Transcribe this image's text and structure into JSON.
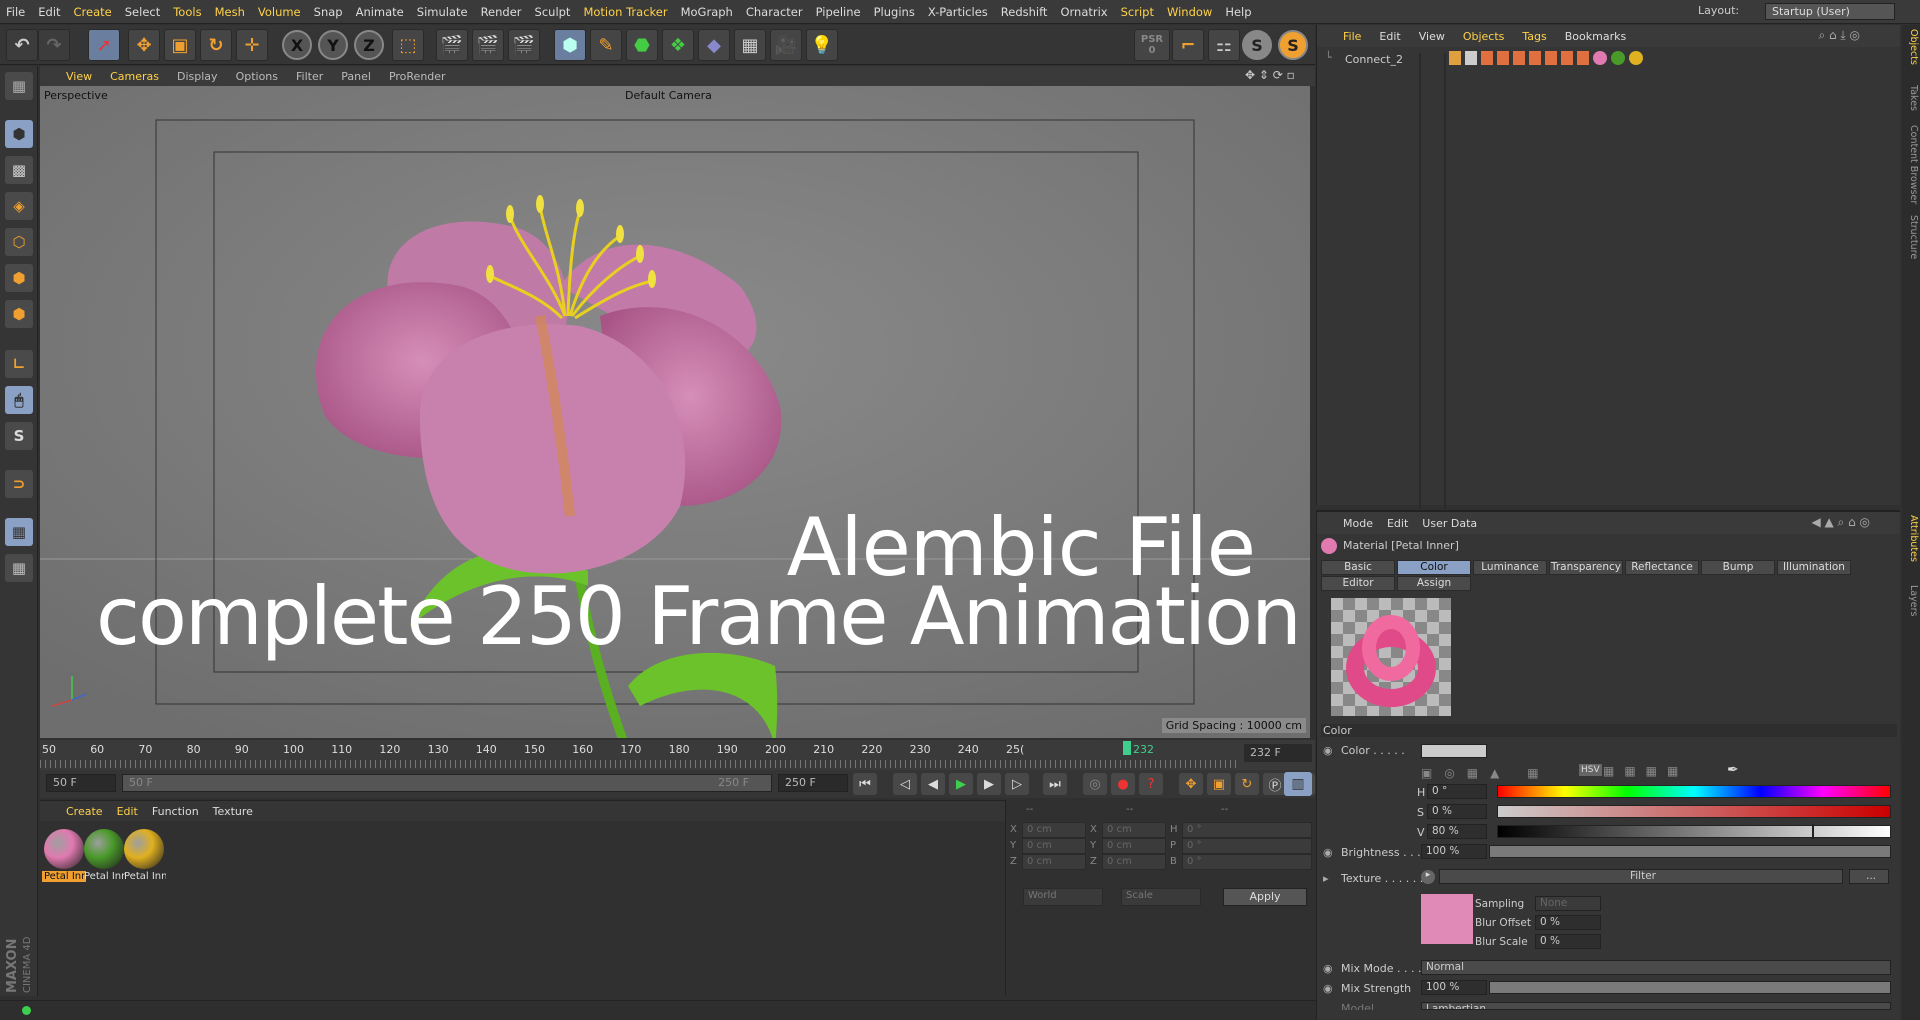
{
  "menu": [
    "File",
    "Edit",
    "Create",
    "Select",
    "Tools",
    "Mesh",
    "Volume",
    "Snap",
    "Animate",
    "Simulate",
    "Render",
    "Sculpt",
    "Motion Tracker",
    "MoGraph",
    "Character",
    "Pipeline",
    "Plugins",
    "X-Particles",
    "Redshift",
    "Ornatrix",
    "Script",
    "Window",
    "Help"
  ],
  "highlighted_menu": [
    "Create",
    "Tools",
    "Mesh",
    "Volume",
    "Motion Tracker",
    "Script",
    "Window"
  ],
  "layout": {
    "label": "Layout:",
    "value": "Startup (User)"
  },
  "toolbar": {
    "axis_x": "X",
    "axis_y": "Y",
    "axis_z": "Z",
    "psr_label": "PSR",
    "psr_value": "0",
    "snap_s1": "S",
    "snap_s2": "S"
  },
  "viewport": {
    "menu": [
      "View",
      "Cameras",
      "Display",
      "Options",
      "Filter",
      "Panel",
      "ProRender"
    ],
    "projection": "Perspective",
    "camera": "Default Camera",
    "overlay_title": "Alembic File",
    "overlay_subtitle": "complete 250 Frame Animation",
    "grid_spacing": "Grid Spacing : 10000 cm"
  },
  "timeline": {
    "ticks": [
      "50",
      "60",
      "70",
      "80",
      "90",
      "100",
      "110",
      "120",
      "130",
      "140",
      "150",
      "160",
      "170",
      "180",
      "190",
      "200",
      "210",
      "220",
      "230",
      "240",
      "25("
    ],
    "current_marker": "232",
    "current_frame": "232 F"
  },
  "transport": {
    "start": "50 F",
    "range_start": "50 F",
    "range_end": "250 F",
    "end": "250 F"
  },
  "material_manager": {
    "menu": [
      "Create",
      "Edit",
      "Function",
      "Texture"
    ],
    "materials": [
      {
        "label": "Petal Inn",
        "color": "#e07ab0",
        "selected": true
      },
      {
        "label": "Petal Inn",
        "color": "#4a9a2a",
        "selected": false
      },
      {
        "label": "Petal Inn",
        "color": "#e0b020",
        "selected": false
      }
    ]
  },
  "coords": {
    "header": [
      "--",
      "--",
      "--"
    ],
    "rows": [
      {
        "a": "X",
        "av": "0 cm",
        "b": "X",
        "bv": "0 cm",
        "c": "H",
        "cv": "0 °"
      },
      {
        "a": "Y",
        "av": "0 cm",
        "b": "Y",
        "bv": "0 cm",
        "c": "P",
        "cv": "0 °"
      },
      {
        "a": "Z",
        "av": "0 cm",
        "b": "Z",
        "bv": "0 cm",
        "c": "B",
        "cv": "0 °"
      }
    ],
    "mode1": "World",
    "mode2": "Scale",
    "apply": "Apply"
  },
  "object_manager": {
    "menu": [
      "File",
      "Edit",
      "View",
      "Objects",
      "Tags",
      "Bookmarks"
    ],
    "object_name": "Connect_2"
  },
  "attributes": {
    "menu": [
      "Mode",
      "Edit",
      "User Data"
    ],
    "title": "Material [Petal Inner]",
    "tabs_row1": [
      "Basic",
      "Color",
      "Luminance",
      "Transparency",
      "Reflectance",
      "Bump",
      "Illumination"
    ],
    "tabs_row2": [
      "Editor",
      "Assign"
    ],
    "selected_tab": "Color",
    "section": "Color",
    "color_label": "Color . . . . .",
    "h_label": "H",
    "h_value": "0 °",
    "s_label": "S",
    "s_value": "0 %",
    "v_label": "V",
    "v_value": "80 %",
    "v_level": 0.8,
    "hsv_tag": "HSV",
    "brightness_label": "Brightness . . .",
    "brightness_value": "100 %",
    "brightness_level": 1.0,
    "texture_label": "Texture . . . . . .",
    "filter": "Filter",
    "more": "...",
    "sampling_label": "Sampling",
    "sampling_value": "None",
    "blur_offset_label": "Blur Offset",
    "blur_offset_value": "0 %",
    "blur_scale_label": "Blur Scale",
    "blur_scale_value": "0 %",
    "mix_mode_label": "Mix Mode . . . .",
    "mix_mode_value": "Normal",
    "mix_strength_label": "Mix Strength",
    "mix_strength_value": "100 %",
    "mix_strength_level": 1.0,
    "cut_label": "Model",
    "cut_value": "Lambertian"
  },
  "side_tabs": [
    "Objects",
    "Takes",
    "Content Browser",
    "Structure"
  ],
  "side_tabs_lower": [
    "Attributes",
    "Layers"
  ],
  "brand": {
    "line1": "MAXON",
    "line2": "CINEMA 4D"
  }
}
